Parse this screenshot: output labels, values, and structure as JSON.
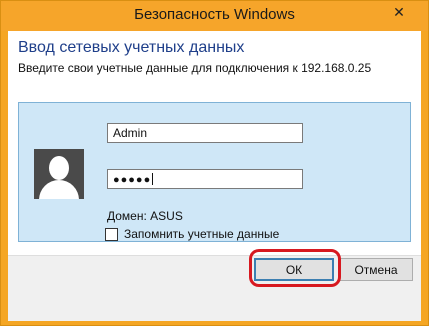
{
  "window": {
    "title": "Безопасность Windows",
    "close_glyph": "✕"
  },
  "dialog": {
    "heading": "Ввод сетевых учетных данных",
    "subtext": "Введите свои учетные данные для подключения к 192.168.0.25"
  },
  "credentials": {
    "username_value": "Admin",
    "password_mask": "●●●●●",
    "domain_text": "Домен: ASUS",
    "remember_label": "Запомнить учетные данные",
    "remember_checked": false
  },
  "buttons": {
    "ok_label": "ОК",
    "cancel_label": "Отмена"
  },
  "colors": {
    "titlebar": "#f6a52a",
    "heading_blue": "#1f3f8a",
    "panel_bg": "#cfe7f7",
    "highlight_red": "#d71920"
  }
}
